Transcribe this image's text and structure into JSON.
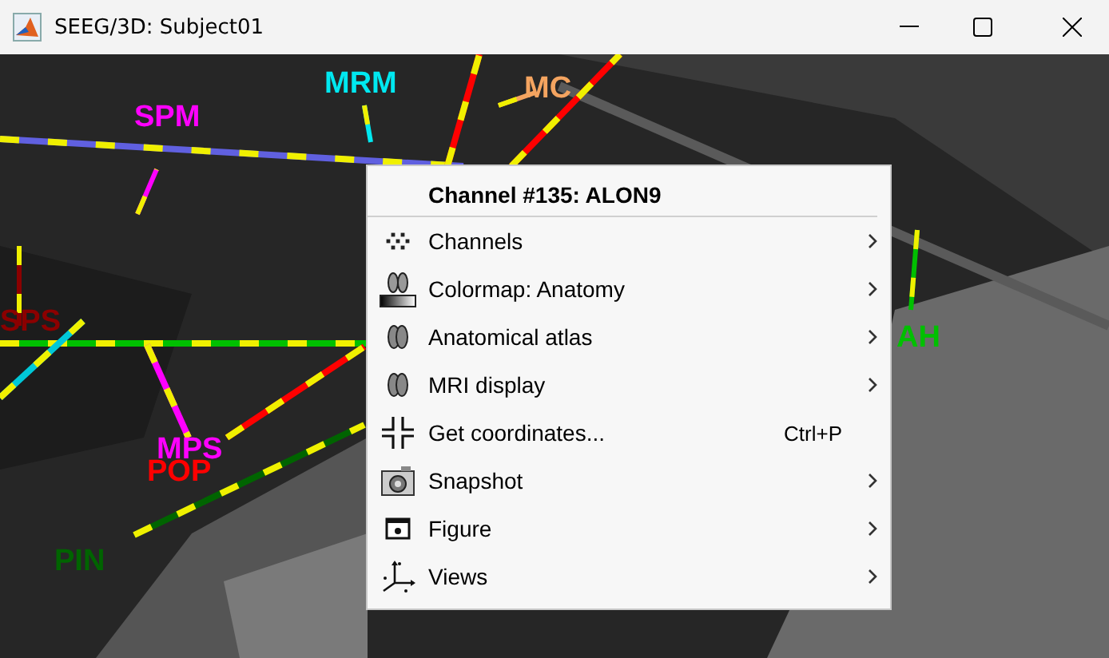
{
  "window": {
    "title": "SEEG/3D: Subject01"
  },
  "electrodes": [
    {
      "label": "MRM",
      "color": "#00e8f0"
    },
    {
      "label": "MC",
      "color": "#f4a460"
    },
    {
      "label": "SPM",
      "color": "#ff00ff"
    },
    {
      "label": "SPS",
      "color": "#8b0000"
    },
    {
      "label": "MPS",
      "color": "#ff00ff"
    },
    {
      "label": "POP",
      "color": "#ff0000"
    },
    {
      "label": "PIN",
      "color": "#006400"
    },
    {
      "label": "AH",
      "color": "#00c000"
    }
  ],
  "context_menu": {
    "header": "Channel #135: ALON9",
    "items": [
      {
        "kind": "channels",
        "label": "Channels",
        "submenu": true
      },
      {
        "kind": "colormap",
        "label": "Colormap: Anatomy",
        "submenu": true
      },
      {
        "kind": "atlas",
        "label": "Anatomical atlas",
        "submenu": true
      },
      {
        "kind": "atlas",
        "label": "MRI display",
        "submenu": true
      },
      {
        "kind": "crosshair",
        "label": "Get coordinates...",
        "shortcut": "Ctrl+P",
        "submenu": false
      },
      {
        "kind": "camera",
        "label": "Snapshot",
        "submenu": true
      },
      {
        "kind": "figure",
        "label": "Figure",
        "submenu": true
      },
      {
        "kind": "axes",
        "label": "Views",
        "submenu": true
      }
    ]
  }
}
